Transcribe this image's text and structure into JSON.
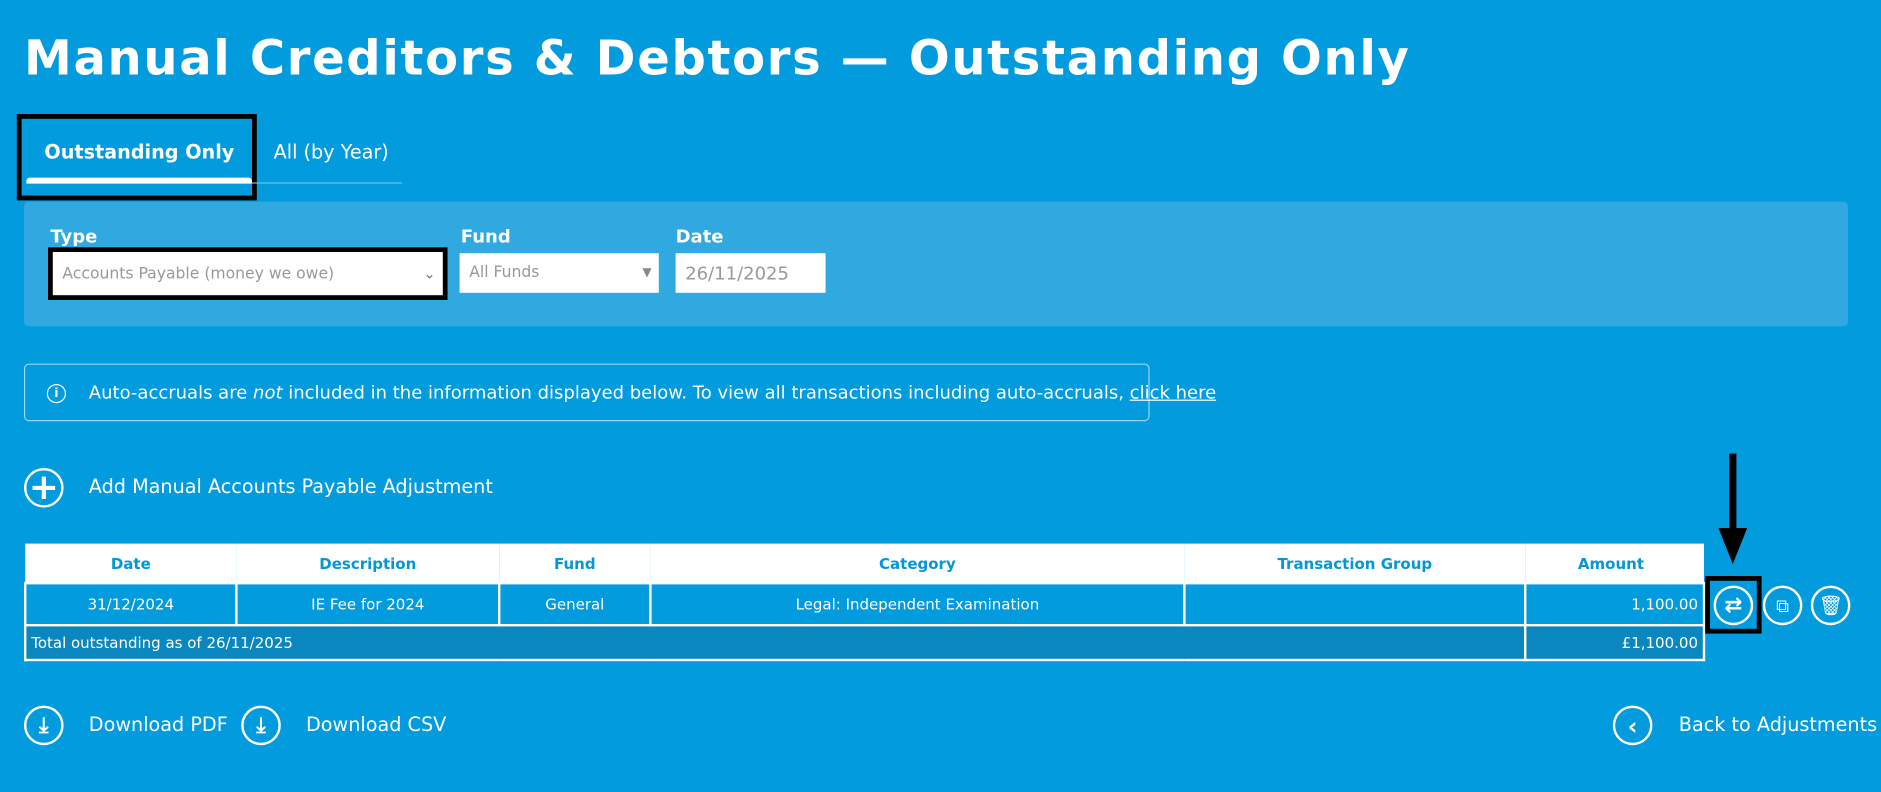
{
  "page": {
    "title": "Manual Creditors & Debtors — Outstanding Only"
  },
  "tabs": [
    {
      "label": "Outstanding Only",
      "active": true
    },
    {
      "label": "All (by Year)",
      "active": false
    }
  ],
  "filters": {
    "type_label": "Type",
    "type_value": "Accounts Payable (money we owe)",
    "fund_label": "Fund",
    "fund_value": "All Funds",
    "date_label": "Date",
    "date_value": "26/11/2025"
  },
  "info": {
    "text_before": "Auto-accruals are ",
    "emphasis": "not",
    "text_after": " included in the information displayed below. To view all transactions including auto-accruals, ",
    "link": "click here"
  },
  "add_label": "Add Manual Accounts Payable Adjustment",
  "table": {
    "headers": [
      "Date",
      "Description",
      "Fund",
      "Category",
      "Transaction Group",
      "Amount"
    ],
    "rows": [
      [
        "31/12/2024",
        "IE Fee for 2024",
        "General",
        "Legal: Independent Examination",
        "",
        "1,100.00"
      ]
    ],
    "total_label": "Total outstanding as of 26/11/2025",
    "total_value": "£1,100.00"
  },
  "footer": {
    "download_pdf": "Download PDF",
    "download_csv": "Download CSV",
    "back": "Back to Adjustments"
  },
  "colors": {
    "background": "#019bde",
    "panel": "#2fa9e0",
    "total_row": "#0a87be"
  }
}
